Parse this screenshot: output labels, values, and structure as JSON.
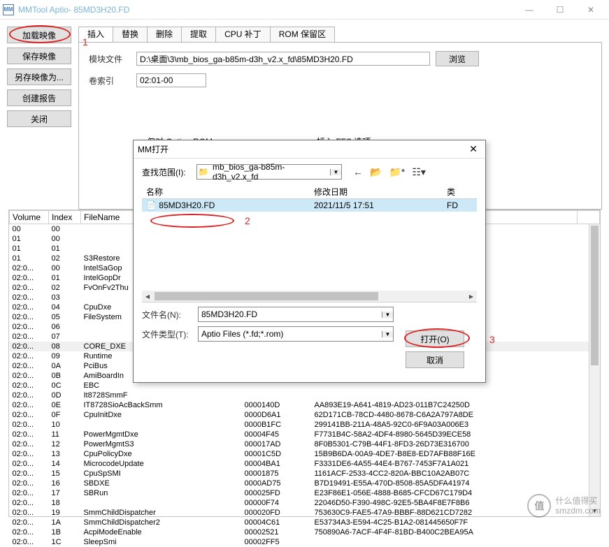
{
  "title": "MMTool Aptio- 85MD3H20.FD",
  "title_icon": "MM",
  "sidebar": {
    "load": "加载映像",
    "save": "保存映像",
    "saveas": "另存映像为...",
    "report": "创建报告",
    "close": "关闭"
  },
  "tabs": [
    "插入",
    "替换",
    "删除",
    "提取",
    "CPU 补丁",
    "ROM 保留区"
  ],
  "insert": {
    "module_label": "模块文件",
    "module_value": "D:\\桌面\\3\\mb_bios_ga-b85m-d3h_v2.x_fd\\85MD3H20.FD",
    "browse": "浏览",
    "vol_label": "卷索引",
    "vol_value": "02:01-00",
    "group1": "仅对 Option ROM",
    "group2": "插入 FFS 选项"
  },
  "annotations": {
    "a1": "1",
    "a2": "2",
    "a3": "3"
  },
  "dialog": {
    "title": "打开",
    "lookin": "查找范围(I):",
    "folder": "mb_bios_ga-b85m-d3h_v2.x_fd",
    "nav": {
      "back": "←",
      "up": "folder-up",
      "new": "new-folder",
      "view": "view"
    },
    "cols": {
      "name": "名称",
      "date": "修改日期",
      "type": "类"
    },
    "file": {
      "name": "85MD3H20.FD",
      "date": "2021/11/5 17:51",
      "type": "FD"
    },
    "fname_label": "文件名(N):",
    "fname_value": "85MD3H20.FD",
    "ftype_label": "文件类型(T):",
    "ftype_value": "Aptio Files (*.fd;*.rom)",
    "open": "打开(O)",
    "cancel": "取消"
  },
  "table": {
    "headers": [
      "Volume",
      "Index",
      "FileName",
      "",
      "",
      ""
    ],
    "rows": [
      [
        "00",
        "00",
        "",
        "",
        "",
        ""
      ],
      [
        "01",
        "00",
        "",
        "",
        "",
        ""
      ],
      [
        "01",
        "01",
        "",
        "",
        "",
        ""
      ],
      [
        "01",
        "02",
        "S3Restore",
        "",
        "",
        ""
      ],
      [
        "02:0...",
        "00",
        "IntelSaGop",
        "",
        "",
        ""
      ],
      [
        "02:0...",
        "01",
        "IntelGopDr",
        "",
        "",
        ""
      ],
      [
        "02:0...",
        "02",
        "FvOnFv2Thu",
        "",
        "",
        ""
      ],
      [
        "02:0...",
        "03",
        "",
        "",
        "",
        ""
      ],
      [
        "02:0...",
        "04",
        "CpuDxe",
        "",
        "",
        ""
      ],
      [
        "02:0...",
        "05",
        "FileSystem",
        "",
        "",
        ""
      ],
      [
        "02:0...",
        "06",
        "",
        "",
        "",
        ""
      ],
      [
        "02:0...",
        "07",
        "",
        "",
        "",
        ""
      ],
      [
        "02:0...",
        "08",
        "CORE_DXE",
        "",
        "",
        ""
      ],
      [
        "02:0...",
        "09",
        "Runtime",
        "",
        "",
        ""
      ],
      [
        "02:0...",
        "0A",
        "PciBus",
        "",
        "",
        ""
      ],
      [
        "02:0...",
        "0B",
        "AmiBoardIn",
        "",
        "",
        ""
      ],
      [
        "02:0...",
        "0C",
        "EBC",
        "",
        "",
        ""
      ],
      [
        "02:0...",
        "0D",
        "It8728SmmF",
        "",
        "",
        ""
      ],
      [
        "02:0...",
        "0E",
        "IT8728SioAcBackSmm",
        "0000140D",
        "AA893E19-A641-4819-AD23-011B7C24250D",
        ""
      ],
      [
        "02:0...",
        "0F",
        "CpuInitDxe",
        "0000D6A1",
        "62D171CB-78CD-4480-8678-C6A2A797A8DE",
        ""
      ],
      [
        "02:0...",
        "10",
        "",
        "0000B1FC",
        "299141BB-211A-48A5-92C0-6F9A03A006E3",
        ""
      ],
      [
        "02:0...",
        "11",
        "PowerMgmtDxe",
        "00004F45",
        "F7731B4C-58A2-4DF4-8980-5645D39ECE58",
        ""
      ],
      [
        "02:0...",
        "12",
        "PowerMgmtS3",
        "000017AD",
        "8F0B5301-C79B-44F1-8FD3-26D73E316700",
        ""
      ],
      [
        "02:0...",
        "13",
        "CpuPolicyDxe",
        "00001C5D",
        "15B9B6DA-00A9-4DE7-B8E8-ED7AFB88F16E",
        ""
      ],
      [
        "02:0...",
        "14",
        "MicrocodeUpdate",
        "00004BA1",
        "F3331DE6-4A55-44E4-B767-7453F7A1A021",
        ""
      ],
      [
        "02:0...",
        "15",
        "CpuSpSMI",
        "00001875",
        "1161ACF-2533-4CC2-820A-BBC10A2AB07C",
        ""
      ],
      [
        "02:0...",
        "16",
        "SBDXE",
        "0000AD75",
        "B7D19491-E55A-470D-8508-85A5DFA41974",
        ""
      ],
      [
        "02:0...",
        "17",
        "SBRun",
        "000025FD",
        "E23F86E1-056E-4888-B685-CFCD67C179D4",
        ""
      ],
      [
        "02:0...",
        "18",
        "",
        "00000F74",
        "22046D50-F390-498C-92E5-5BA4F8E7F8B6",
        ""
      ],
      [
        "02:0...",
        "19",
        "SmmChildDispatcher",
        "000020FD",
        "753630C9-FAE5-47A9-BBBF-88D621CD7282",
        ""
      ],
      [
        "02:0...",
        "1A",
        "SmmChildDispatcher2",
        "00004C61",
        "E53734A3-E594-4C25-B1A2-081445650F7F",
        ""
      ],
      [
        "02:0...",
        "1B",
        "AcpiModeEnable",
        "00002521",
        "750890A6-7ACF-4F4F-81BD-B400C2BEA95A",
        ""
      ],
      [
        "02:0...",
        "1C",
        "SleepSmi",
        "00002FF5",
        "",
        ""
      ]
    ]
  },
  "watermark": {
    "logo": "值",
    "line1": "什么值得买",
    "line2": "smzdm.com"
  }
}
